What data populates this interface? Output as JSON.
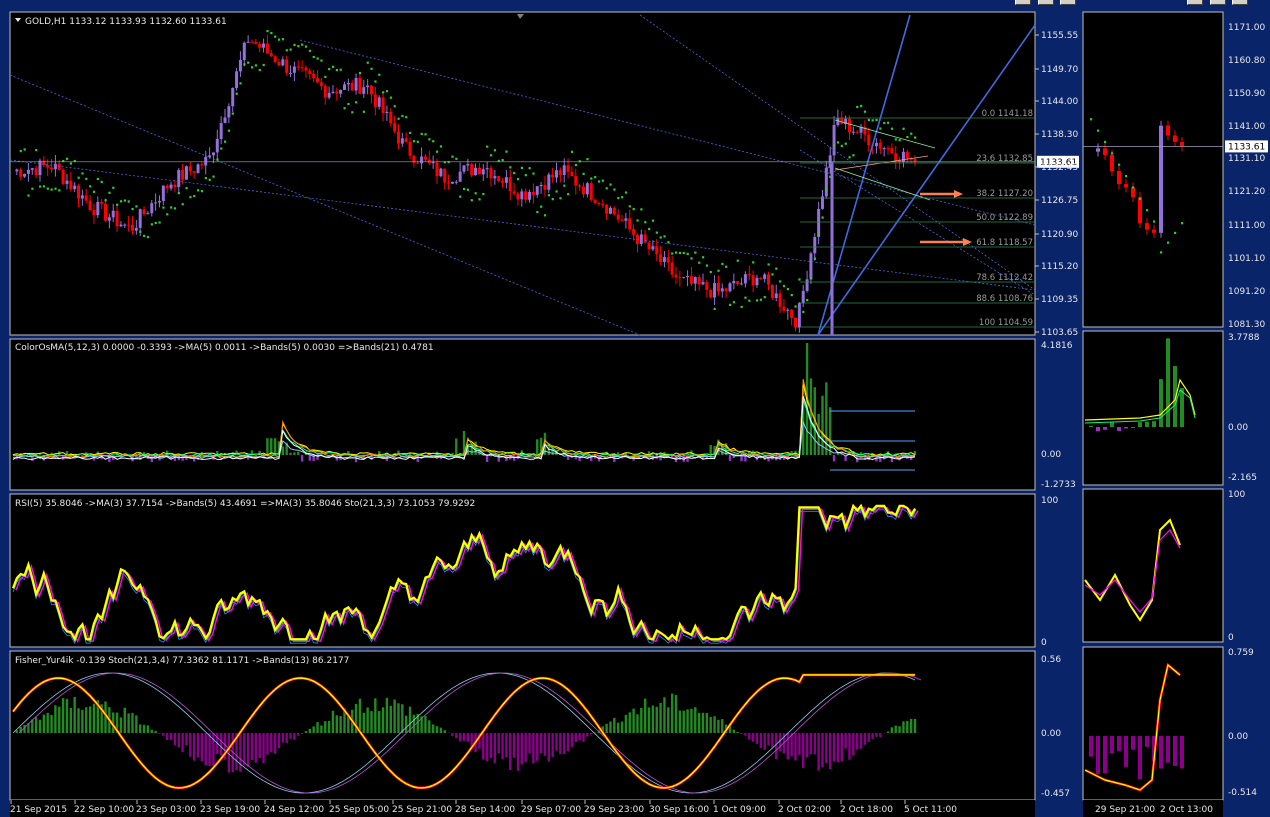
{
  "window_main": {
    "header": "GOLD,H1  1133.12 1133.93 1132.60 1133.61",
    "price_ticks": [
      "1155.55",
      "1149.70",
      "1144.00",
      "1138.30",
      "1132.45",
      "1126.75",
      "1120.90",
      "1115.20",
      "1109.35",
      "1103.65"
    ],
    "current_price": "1133.61",
    "fib_levels": [
      "0.0 1141.18",
      "23.6 1132.85",
      "38.2 1127.20",
      "50.0 1122.89",
      "61.8 1118.57",
      "78.6 1112.42",
      "88.6 1108.76",
      "100 1104.59"
    ],
    "osma_header": "ColorOsMA(5,12,3) 0.0000 -0.3393  ->MA(5) 0.0011  ->Bands(5) 0.0030  =>Bands(21) 0.4781",
    "osma_ticks": [
      "4.1816",
      "0.00",
      "-1.2733"
    ],
    "rsi_header": "RSI(5) 35.8046  ->MA(3) 37.7154  ->Bands(5) 43.4691  =>MA(3) 35.8046  Sto(21,3,3) 73.1053 79.9292",
    "rsi_ticks": [
      "100",
      "0"
    ],
    "fisher_header": "Fisher_Yur4ik -0.139  Stoch(21,3,4) 77.3362 81.1171  ->Bands(13) 86.2177",
    "fisher_ticks": [
      "0.56",
      "0.00",
      "-0.457"
    ],
    "time_labels": [
      "21 Sep 2015",
      "22 Sep 10:00",
      "23 Sep 03:00",
      "23 Sep 19:00",
      "24 Sep 12:00",
      "25 Sep 05:00",
      "25 Sep 21:00",
      "28 Sep 14:00",
      "29 Sep 07:00",
      "29 Sep 23:00",
      "30 Sep 16:00",
      "1 Oct 09:00",
      "2 Oct 02:00",
      "2 Oct 18:00",
      "5 Oct 11:00"
    ]
  },
  "window_side": {
    "price_ticks": [
      "1171.00",
      "1160.80",
      "1150.90",
      "1141.00",
      "1131.10",
      "1121.20",
      "1111.00",
      "1101.10",
      "1091.20",
      "1081.30"
    ],
    "current_price": "1133.61",
    "osma_ticks": [
      "3.7788",
      "0.00",
      "-2.165"
    ],
    "rsi_ticks": [
      "100",
      "0"
    ],
    "fisher_ticks": [
      "0.759",
      "0.00",
      "-0.514"
    ],
    "time_labels": [
      "29 Sep 21:00",
      "2 Oct 13:00"
    ]
  },
  "colors": {
    "bull": "#9370db",
    "bear": "#ff0000",
    "psar": "#32cd32",
    "channel": "#4169e1",
    "rsi_line": "#ffff00",
    "ma_line": "#ff00ff",
    "fib_arrow": "#ff7f50"
  },
  "chart_data": [
    {
      "type": "line",
      "title": "GOLD,H1",
      "series": [
        {
          "name": "GOLD,H1",
          "values": [
            1132,
            1133,
            1126,
            1122,
            1130,
            1134,
            1155,
            1150,
            1146,
            1147,
            1136,
            1131,
            1133,
            1128,
            1132,
            1127,
            1120,
            1113,
            1111,
            1114,
            1106,
            1141,
            1137,
            1133.61
          ]
        }
      ],
      "ylim": [
        1103.65,
        1155.55
      ]
    },
    {
      "type": "bar",
      "title": "ColorOsMA(5,12,3)",
      "ylim": [
        -1.2733,
        4.1816
      ]
    },
    {
      "type": "line",
      "title": "RSI(5)",
      "ylim": [
        0,
        100
      ]
    },
    {
      "type": "line",
      "title": "Fisher_Yur4ik",
      "ylim": [
        -0.457,
        0.56
      ]
    }
  ]
}
